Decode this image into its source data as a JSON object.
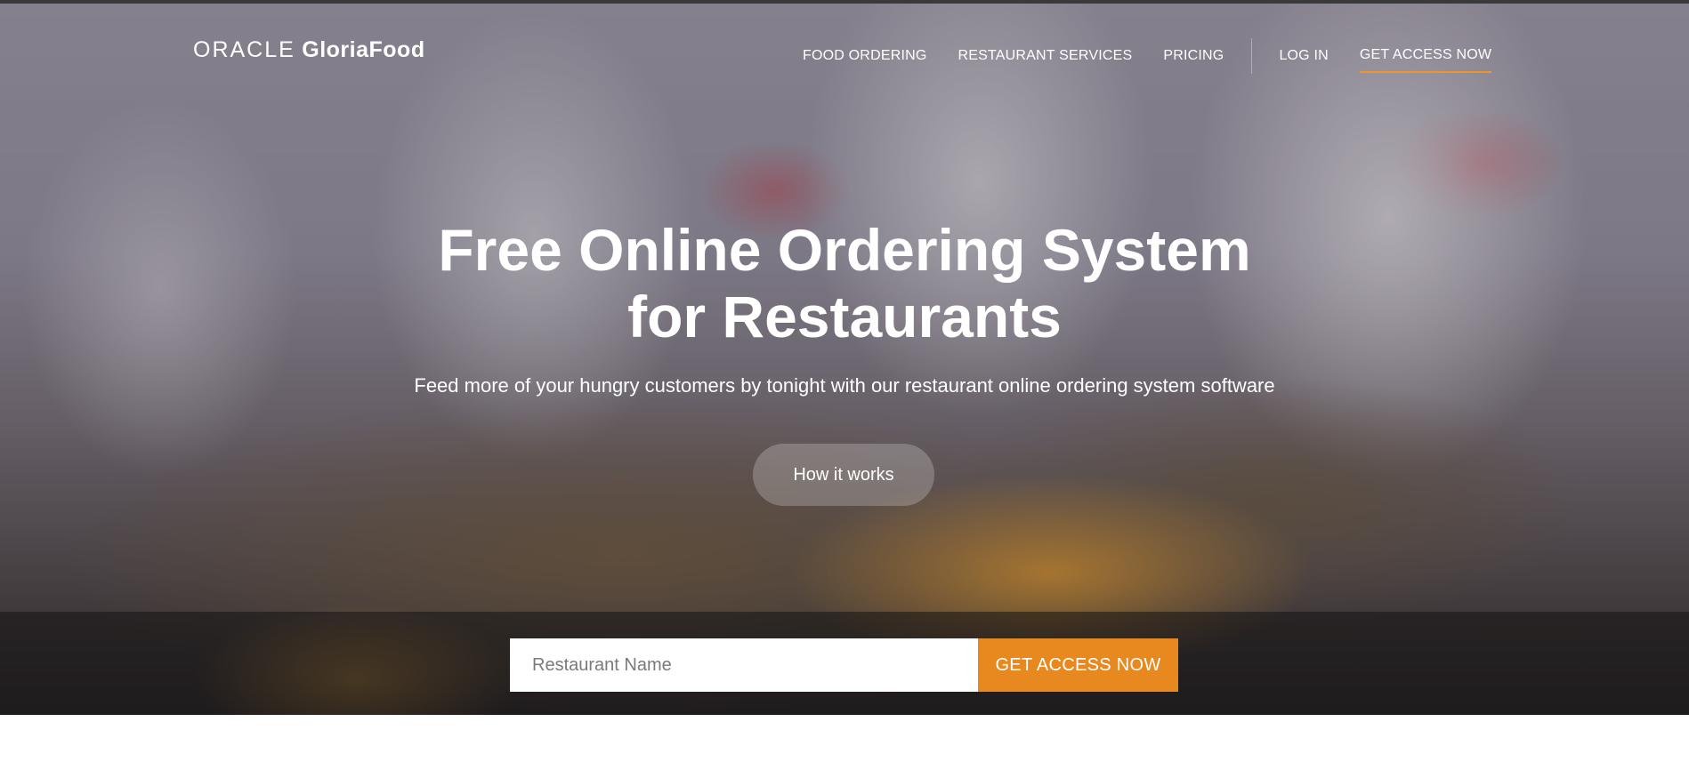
{
  "colors": {
    "accent": "#e8891f",
    "nav_underline": "#f0932b",
    "text_on_hero": "#ffffff"
  },
  "header": {
    "logo_part1": "ORACLE",
    "logo_part2": "GloriaFood",
    "nav": {
      "food_ordering": "FOOD ORDERING",
      "restaurant_services": "RESTAURANT SERVICES",
      "pricing": "PRICING",
      "login": "LOG IN",
      "get_access": "GET ACCESS NOW"
    }
  },
  "hero": {
    "background": "blurred restaurant kitchen with chefs and flaming woks",
    "title_line1": "Free Online Ordering System",
    "title_line2": "for Restaurants",
    "subtitle": "Feed more of your hungry customers by tonight with our restaurant online ordering system software",
    "how_it_works": "How it works"
  },
  "signup": {
    "placeholder": "Restaurant Name",
    "value": "",
    "button": "GET ACCESS NOW"
  }
}
